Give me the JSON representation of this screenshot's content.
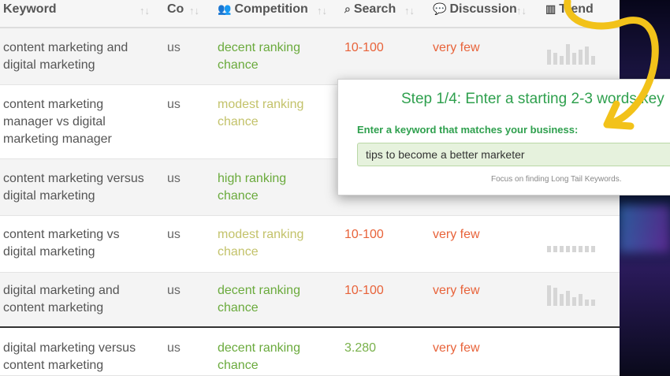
{
  "header": {
    "keyword": "Keyword",
    "country": "Co",
    "competition": "Competition",
    "search": "Search",
    "discussion": "Discussion",
    "trend": "Trend"
  },
  "rows": [
    {
      "keyword": "content marketing and digital marketing",
      "country": "us",
      "competition": "decent ranking chance",
      "search": "10-100",
      "discussion": "very few",
      "trend": [
        10,
        8,
        6,
        14,
        8,
        10,
        12,
        6
      ]
    },
    {
      "keyword": "content marketing manager vs digital marketing manager",
      "country": "us",
      "competition": "modest ranking chance",
      "search": "",
      "discussion": "",
      "trend": []
    },
    {
      "keyword": "content marketing versus digital marketing",
      "country": "us",
      "competition": "high ranking chance",
      "search": "",
      "discussion": "",
      "trend": []
    },
    {
      "keyword": "content marketing vs digital marketing",
      "country": "us",
      "competition": "modest ranking chance",
      "search": "10-100",
      "discussion": "very few",
      "trend": [
        4,
        4,
        4,
        4,
        4,
        4,
        4,
        4
      ]
    },
    {
      "keyword": "digital marketing and content marketing",
      "country": "us",
      "competition": "decent ranking chance",
      "search": "10-100",
      "discussion": "very few",
      "trend": [
        14,
        12,
        8,
        10,
        6,
        8,
        4,
        4
      ]
    },
    {
      "keyword": "digital marketing versus content marketing",
      "country": "us",
      "competition": "decent ranking chance",
      "search": "3.280",
      "discussion": "very few",
      "trend": []
    }
  ],
  "modal": {
    "title": "Step 1/4: Enter a starting 2-3 words key",
    "label": "Enter a keyword that matches your business:",
    "input_value": "tips to become a better marketer",
    "hint": "Focus on finding Long Tail Keywords."
  },
  "colors": {
    "green": "#6aaa3c",
    "olive": "#c3c26a",
    "red": "#e8633a",
    "arrow": "#f2c21a"
  }
}
